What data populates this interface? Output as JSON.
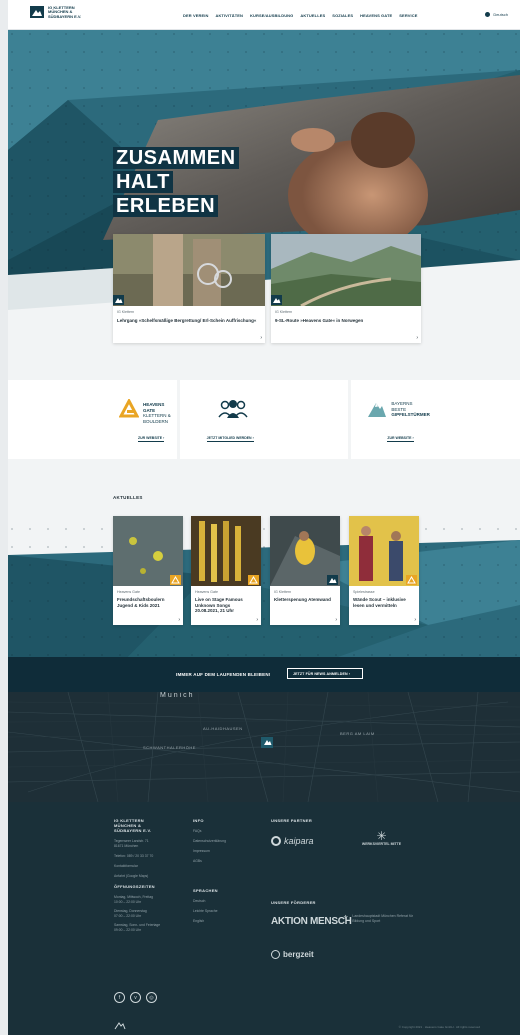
{
  "header": {
    "logo_text": "IG KLETTERN MÜNCHEN & SÜDBAYERN E.V.",
    "nav": [
      "DER VEREIN",
      "AKTIVITÄTEN",
      "KURSE/AUSBILDUNG",
      "AKTUELLES",
      "SOZIALES",
      "HEAVENS GATE",
      "SERVICE"
    ],
    "language": "Deutsch"
  },
  "hero": {
    "title_lines": [
      "ZUSAMMEN",
      "HALT",
      "ERLEBEN"
    ],
    "cards": [
      {
        "category": "IG Klettern",
        "title": "Lehrgang »Schelfsmäßige Bergrettung/ Erl-Schein Auffrischung«"
      },
      {
        "category": "IG Klettern",
        "title": "9-SL-Route »Heavens Gate« in Norwegen"
      }
    ]
  },
  "partners": [
    {
      "name_line1": "HEAVENS GATE",
      "name_line2": "KLETTERN &",
      "name_line3": "BOULDERN",
      "link": "ZUR WEBSITE"
    },
    {
      "link": "JETZT MITGLIED WERDEN"
    },
    {
      "name_line1": "BAYERNS",
      "name_line2": "BESTE",
      "name_line3": "GIPFELSTÜRMER",
      "link": "ZUR WEBSITE"
    }
  ],
  "news": {
    "heading": "AKTUELLES",
    "cards": [
      {
        "category": "Heavens Gate",
        "title": "Freundschaftsboulern Jugend & Kids 2021"
      },
      {
        "category": "Heavens Gate",
        "title": "Live on Stage Famous Unknown Songs 20.08.2021, 21 Uhr"
      },
      {
        "category": "IG Klettern",
        "title": "Kletterspenung Atemwand"
      },
      {
        "category": "Spielestrasse",
        "title": "Wände Scout – inklusive lesen und vermitteln"
      }
    ]
  },
  "newsletter": {
    "text": "IMMER AUF DEM LAUFENDEN BLEIBEN!",
    "button": "JETZT FÜR NEWS ANMELDEN"
  },
  "map": {
    "city": "Munich",
    "district1": "AU-HAIDHAUSEN",
    "district2": "BERG AM LAIM",
    "district3": "SCHWANTHALERHÖHE"
  },
  "footer": {
    "org": [
      "IG KLETTERN",
      "MÜNCHEN &",
      "SÜDBAYERN E.V."
    ],
    "address": [
      "Tegernseer Landstr. 71",
      "81671 München"
    ],
    "phone": "Telefon: 089 / 20 33 37 70",
    "contact": "Kontaktformular",
    "route": "Anfahrt (Google Maps)",
    "hours_heading": "ÖFFNUNGSZEITEN",
    "hours": [
      "Montag, Mittwoch, Freitag",
      "10:00 – 22:00 Uhr",
      "Dienstag, Donnerstag",
      "07:00 – 22:00 Uhr",
      "Samstag, Sonn- und Feiertage",
      "09:00 – 22:00 Uhr"
    ],
    "info_heading": "INFO",
    "info": [
      "FAQs",
      "Datenschutzerklärung",
      "Impressum",
      "AGBs"
    ],
    "lang_heading": "SPRACHEN",
    "langs": [
      "Deutsch",
      "Leichte Sprache",
      "English"
    ],
    "partners_heading": "UNSERE PARTNER",
    "partner1": "kaipara",
    "partner2": "WERKSVIERTEL MITTE",
    "sponsors_heading": "UNSERE FÖRDERER",
    "sponsor1": "AKTION MENSCH",
    "sponsor2": "Landeshauptstadt München Referat für Bildung und Sport",
    "sponsor3": "bergzeit",
    "copyright": "© Copyright 2021 · Heavens Gate GmbH · All rights reserved"
  }
}
